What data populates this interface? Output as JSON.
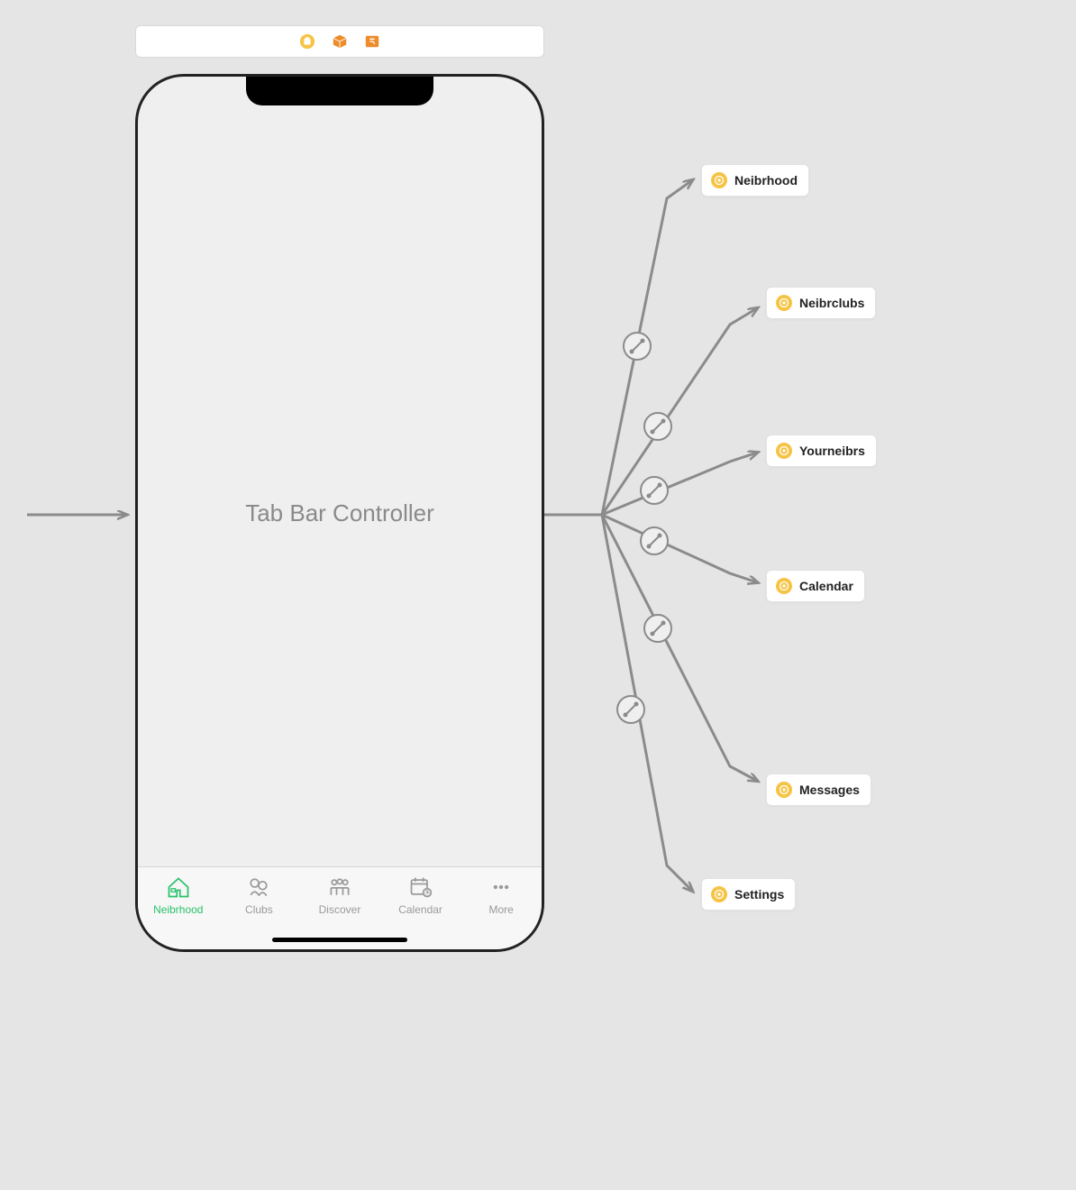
{
  "toolbar": {
    "icons": [
      "storyboard-scene-icon",
      "object-3d-icon",
      "segue-icon"
    ]
  },
  "phone": {
    "title": "Tab Bar Controller",
    "tabs": [
      {
        "label": "Neibrhood",
        "icon": "house-icon",
        "selected": true
      },
      {
        "label": "Clubs",
        "icon": "group-icon",
        "selected": false
      },
      {
        "label": "Discover",
        "icon": "people-icon",
        "selected": false
      },
      {
        "label": "Calendar",
        "icon": "calendar-icon",
        "selected": false
      },
      {
        "label": "More",
        "icon": "ellipsis-icon",
        "selected": false
      }
    ]
  },
  "destinations": [
    {
      "label": "Neibrhood"
    },
    {
      "label": "Neibrclubs"
    },
    {
      "label": "Yourneibrs"
    },
    {
      "label": "Calendar"
    },
    {
      "label": "Messages"
    },
    {
      "label": "Settings"
    }
  ],
  "colors": {
    "selected_tab": "#29c26a",
    "inactive_tab": "#9a9a9a",
    "node_icon": "#f6c445",
    "toolbar_orange": "#ec8c2a",
    "connector": "#8b8b8b",
    "background": "#e5e5e5"
  }
}
